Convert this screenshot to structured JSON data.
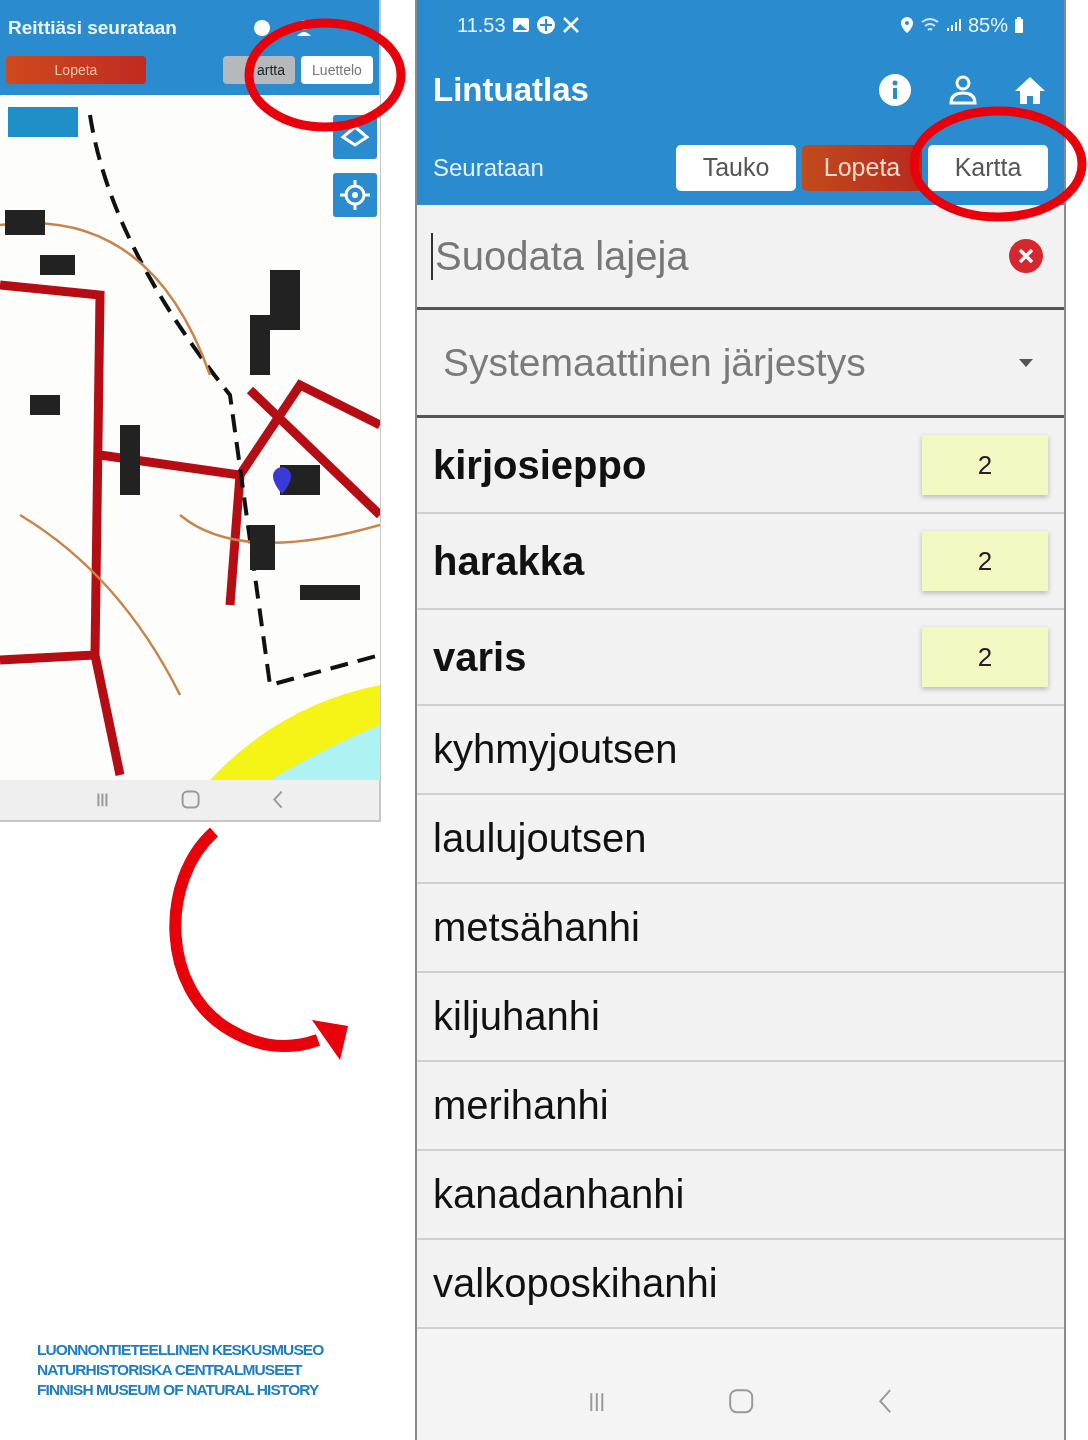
{
  "map_screen": {
    "title": "Reittiäsi seurataan",
    "buttons": [
      {
        "label": "Lopeta",
        "kind": "stop"
      },
      {
        "label": "artta",
        "kind": "toggle",
        "selected": true
      },
      {
        "label": "Luettelo",
        "kind": "toggle",
        "selected": false
      }
    ]
  },
  "list_screen": {
    "status_bar": {
      "time": "11.53",
      "battery": "85%"
    },
    "title": "Lintuatlas",
    "subtitle": "Seurataan",
    "buttons": [
      {
        "label": "Tauko",
        "kind": "plain"
      },
      {
        "label": "Lopeta",
        "kind": "stop"
      },
      {
        "label": "Kartta",
        "kind": "plain"
      }
    ],
    "search": {
      "placeholder": "Suodata lajeja"
    },
    "sort": {
      "value": "Systemaattinen järjestys"
    },
    "species": [
      {
        "name": "kirjosieppo",
        "count": "2"
      },
      {
        "name": "harakka",
        "count": "2"
      },
      {
        "name": "varis",
        "count": "2"
      },
      {
        "name": "kyhmyjoutsen"
      },
      {
        "name": "laulujoutsen"
      },
      {
        "name": "metsähanhi"
      },
      {
        "name": "kiljuhanhi"
      },
      {
        "name": "merihanhi"
      },
      {
        "name": "kanadanhanhi"
      },
      {
        "name": "valkoposkihanhi"
      }
    ]
  },
  "logo": {
    "lines": [
      "LUONNONTIETEELLINEN KESKUSMUSEO",
      "NATURHISTORISKA CENTRALMUSEET",
      "FINNISH MUSEUM OF NATURAL HISTORY"
    ]
  }
}
